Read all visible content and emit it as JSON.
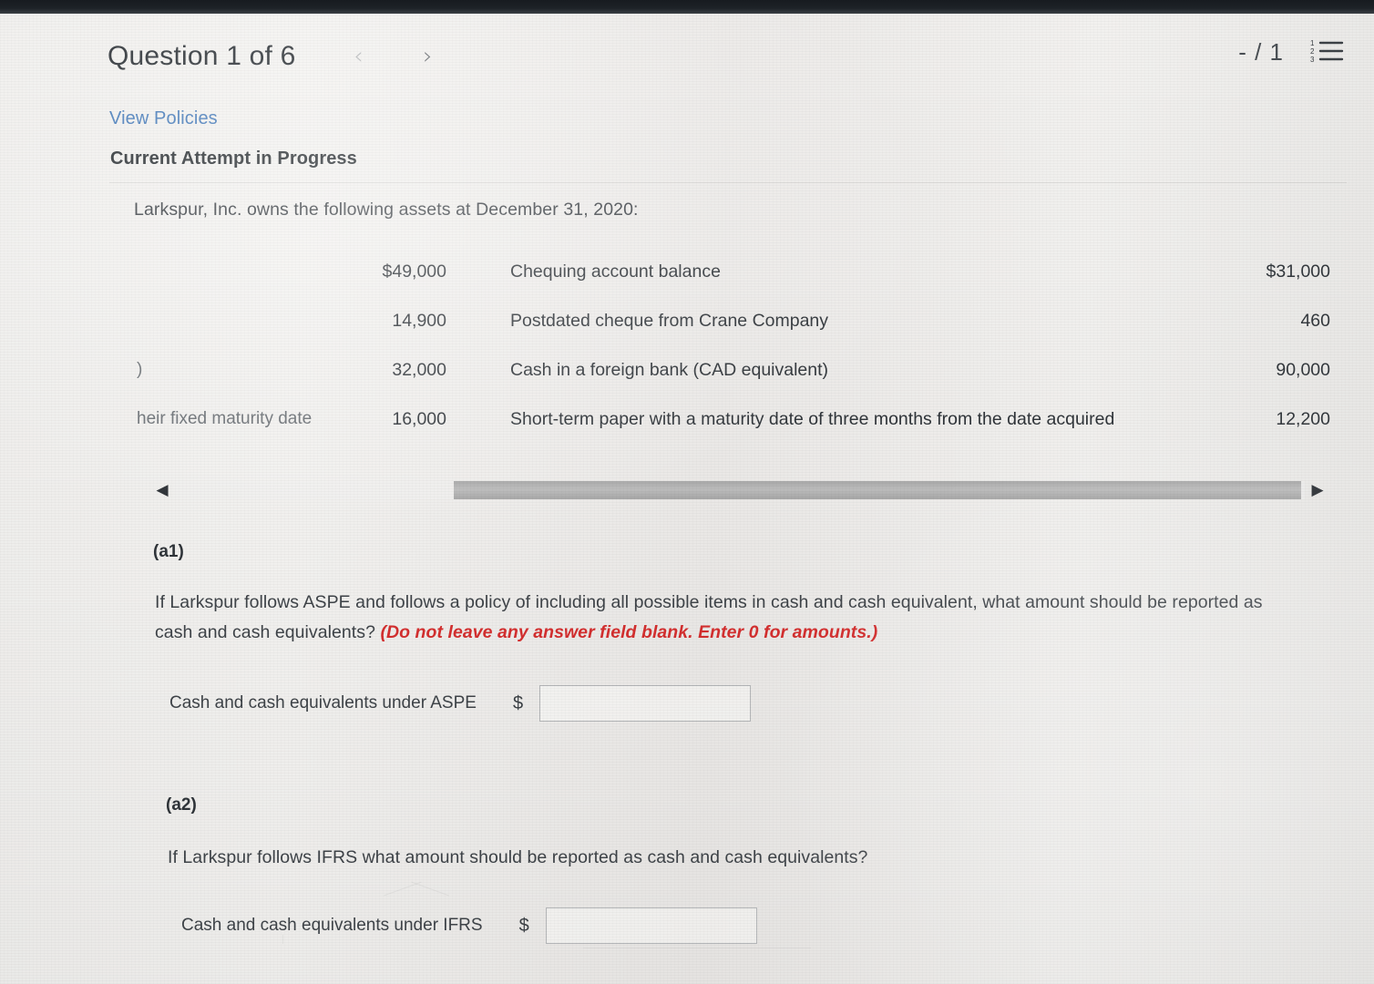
{
  "header": {
    "question_title": "Question 1 of 6",
    "prev_icon": "chevron-left-icon",
    "next_icon": "chevron-right-icon",
    "prev_label": "‹",
    "next_label": "›",
    "score": "- / 1",
    "menu_icon": "numbered-list-icon"
  },
  "links": {
    "view_policies": "View Policies"
  },
  "attempt": {
    "status": "Current Attempt in Progress"
  },
  "question": {
    "intro": "Larkspur, Inc. owns the following assets at December 31, 2020:"
  },
  "assets": {
    "rows": [
      {
        "cut_left": "",
        "amount_left": "$49,000",
        "description": "Chequing account balance",
        "amount_right": "$31,000"
      },
      {
        "cut_left": "",
        "amount_left": "14,900",
        "description": "Postdated cheque from Crane Company",
        "amount_right": "460"
      },
      {
        "cut_left": ")",
        "amount_left": "32,000",
        "description": "Cash in a foreign bank (CAD equivalent)",
        "amount_right": "90,000"
      },
      {
        "cut_left": "heir fixed maturity date",
        "amount_left": "16,000",
        "description": "Short-term paper with a maturity date of three months from the date acquired",
        "amount_right": "12,200"
      }
    ]
  },
  "scrollbar": {
    "left_arrow": "◀",
    "right_arrow": "▶",
    "left_icon": "scroll-left-arrow-icon",
    "right_icon": "scroll-right-arrow-icon"
  },
  "parts": {
    "a1": {
      "label": "(a1)",
      "question_plain": "If Larkspur follows ASPE and follows a policy of including all possible items in cash and cash equivalent, what amount should be reported as cash and cash equivalents? ",
      "question_emphasis": "(Do not leave any answer field blank. Enter 0 for amounts.)",
      "answer_label": "Cash and cash equivalents under ASPE",
      "currency": "$",
      "answer_value": "",
      "answer_placeholder": ""
    },
    "a2": {
      "label": "(a2)",
      "question_plain": "If Larkspur follows IFRS what amount should be reported as cash and cash equivalents?",
      "answer_label": "Cash and cash equivalents under IFRS",
      "currency": "$",
      "answer_value": "",
      "answer_placeholder": ""
    }
  },
  "colors": {
    "link": "#4a7ebb",
    "emphasis": "#d32f2f",
    "text": "#3e4348",
    "page_background": "#f1f0ee"
  }
}
